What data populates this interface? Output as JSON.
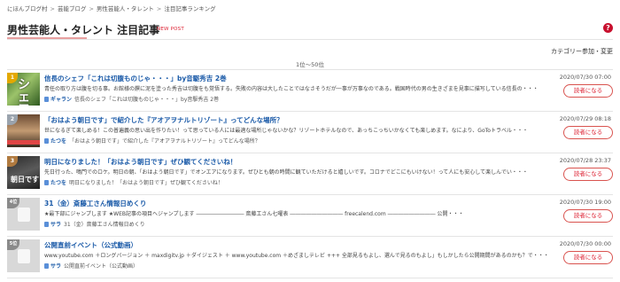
{
  "breadcrumb": [
    "にほんブログ村",
    "芸能ブログ",
    "男性芸能人・タレント",
    "注目記事ランキング"
  ],
  "header": {
    "title": "男性芸能人・タレント 注目記事",
    "badge": "NEW POST",
    "help_icon": "?"
  },
  "category_link": "カテゴリー参加・変更",
  "range_label": "1位〜50位",
  "read_button_label": "読者になる",
  "colors": {
    "link": "#1a5aa8",
    "accent": "#c8102e",
    "button": "#d9534f"
  },
  "articles": [
    {
      "rank": "1",
      "thumb_text": "シェフ",
      "title": "信長のシェフ「これは切腹ものじゃ・・・」by音駆秀吉 2巻",
      "excerpt": "青任の取り方は腹を切る事。お館様の饌に泥を塗った秀吉は切腹をも覚悟する。失敗の内容は大したことではなさそうだが一事が万事なのである。戦国時代の男の生きざまを見事に描写している信長の・・・",
      "author": "ギャラン",
      "meta": "信長のシェフ「これは切腹ものじゃ・・・」by音駆秀吉 2巻",
      "time": "2020/07/30 07:00"
    },
    {
      "rank": "2",
      "thumb_text": "",
      "title": "「おはよう朝日です」で紹介した『アオアヲナルトリゾート』ってどんな場所？",
      "excerpt": "世になるぎて楽しめる！この普遍義の思い出を作りたい！って思っている人には最適な場所じゃないかな？リゾートホテルなので、あっちこっちいかなくても楽しめます。なにより、GoToトラベル・・・",
      "author": "たつを",
      "meta": "「おはよう朝日です」で紹介した『アオアヲナルトリゾート』ってどんな場所？",
      "time": "2020/07/29 08:18"
    },
    {
      "rank": "3",
      "thumb_text": "朝日です",
      "title": "明日になりました！「おはよう朝日です」ぜひ観てくださいね！",
      "excerpt": "先日行った、鳴門でのロケ。明日の朝、「おはよう朝日です」でオンエアになります。ぜひとも朝の時間に観ていただけると嬉しいです。コロナでどこにもいけない！って人にも安心して楽しんでい・・・",
      "author": "たつを",
      "meta": "明日になりました！「おはよう朝日です」ぜひ観てくださいね！",
      "time": "2020/07/28 23:37"
    },
    {
      "rank": "4位",
      "thumb_text": "",
      "title": "31（金）斎藤工さん情報日めくり",
      "excerpt": "★最下部にジャンプします ★WEB記事の項目へジャンプします ――――――――― 斎藤工さん七曜表 ―――――――――― freecalend.com ――――――――― 公開・・・",
      "author": "サラ",
      "meta": "31（金）斎藤工さん情報日めくり",
      "time": "2020/07/30 19:00"
    },
    {
      "rank": "5位",
      "thumb_text": "",
      "title": "公開直前イベント（公式動画）",
      "excerpt": "www.youtube.com ＋ロングバージョン ＋ maxdigitv.jp ＋ダイジェスト ＋ www.youtube.com ＋めざましテレビ +++ 全部見るもよし、選んで見るのもよし」もしかしたら公開期間があるのかも？で・・・",
      "author": "サラ",
      "meta": "公開直前イベント（公式動画）",
      "time": "2020/07/30 00:00"
    }
  ]
}
